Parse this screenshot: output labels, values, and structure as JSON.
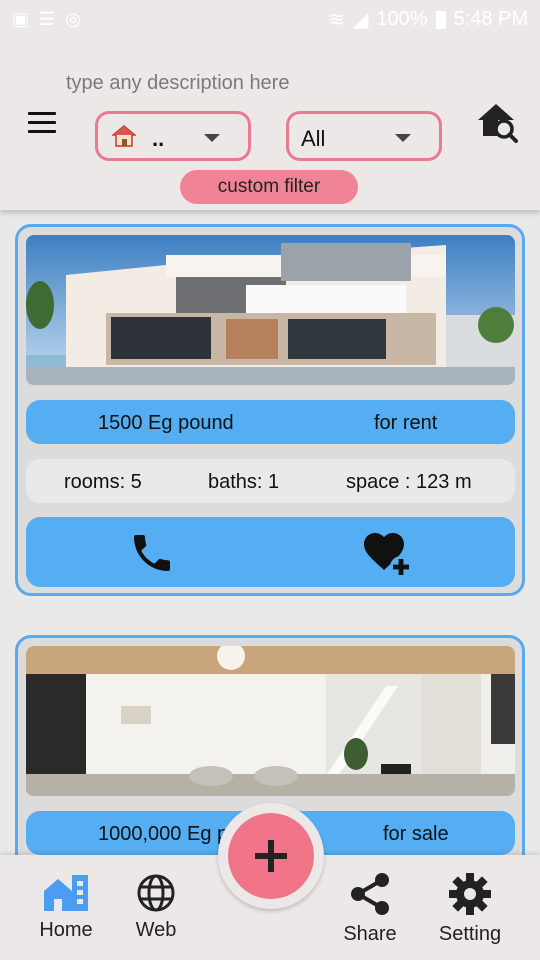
{
  "status_bar": {
    "battery": "100%",
    "time": "5:48 PM"
  },
  "header": {
    "search_placeholder": "type any description here",
    "type_dropdown_value": "..",
    "category_dropdown_value": "All",
    "custom_filter_label": "custom filter"
  },
  "listings": [
    {
      "price": "1500 Eg pound",
      "deal": "for rent",
      "rooms": "rooms: 5",
      "baths": "baths: 1",
      "space": "space : 123 m"
    },
    {
      "price": "1000,000 Eg p",
      "deal": "for sale"
    }
  ],
  "bottom_nav": {
    "home": "Home",
    "web": "Web",
    "share": "Share",
    "setting": "Setting"
  },
  "colors": {
    "accent_blue": "#55aef2",
    "accent_pink": "#f17589",
    "card_border": "#5aa9ef"
  }
}
